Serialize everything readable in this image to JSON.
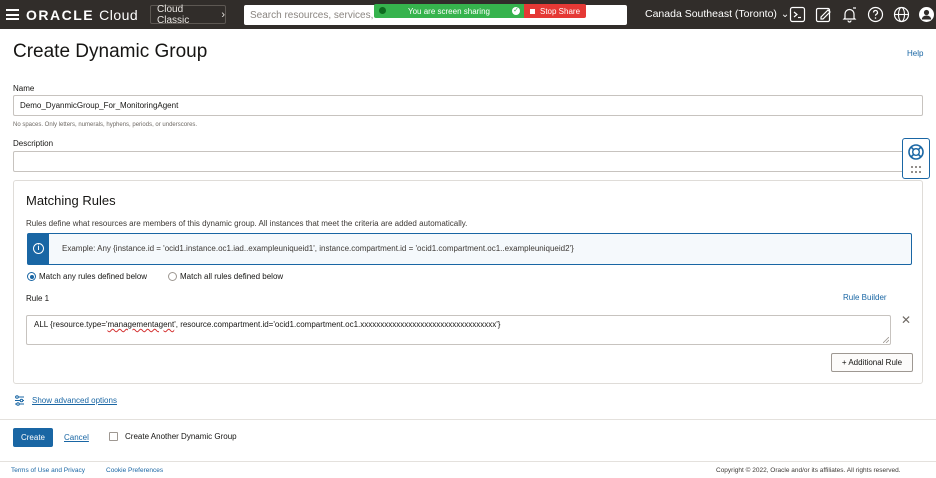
{
  "topbar": {
    "brand": "ORACLE",
    "brand_suffix": "Cloud",
    "classic_label": "Cloud Classic",
    "search_placeholder": "Search resources, services, do",
    "screen_sharing_text": "You are screen sharing",
    "stop_share_label": "Stop Share",
    "region": "Canada Southeast (Toronto)",
    "icons": [
      "terminal-icon",
      "edit-icon",
      "bell-icon",
      "help-icon",
      "globe-icon",
      "user-icon"
    ]
  },
  "page": {
    "title": "Create Dynamic Group",
    "help_link": "Help"
  },
  "form": {
    "name_label": "Name",
    "name_value": "Demo_DyanmicGroup_For_MonitoringAgent",
    "name_hint": "No spaces. Only letters, numerals, hyphens, periods, or underscores.",
    "description_label": "Description",
    "description_value": ""
  },
  "matching_rules": {
    "title": "Matching Rules",
    "description": "Rules define what resources are members of this dynamic group. All instances that meet the criteria are added automatically.",
    "example": "Example: Any {instance.id = 'ocid1.instance.oc1.iad..exampleuniqueid1', instance.compartment.id = 'ocid1.compartment.oc1..exampleuniqueid2'}",
    "options": [
      {
        "label": "Match any rules defined below",
        "selected": true
      },
      {
        "label": "Match all rules defined below",
        "selected": false
      }
    ],
    "rule_label": "Rule 1",
    "rule_builder_link": "Rule Builder",
    "rule_prefix": "ALL {resource.type='",
    "rule_squiggle": "managementagent",
    "rule_suffix": "', resource.compartment.id='ocid1.compartment.oc1.xxxxxxxxxxxxxxxxxxxxxxxxxxxxxxxxxx'}",
    "additional_rule_button": "+ Additional Rule"
  },
  "advanced": {
    "link": "Show advanced options"
  },
  "actions": {
    "create_button": "Create",
    "cancel_link": "Cancel",
    "another_checkbox_label": "Create Another Dynamic Group",
    "another_checked": false
  },
  "footer": {
    "terms": "Terms of Use and Privacy",
    "cookies": "Cookie Preferences",
    "copyright": "Copyright © 2022, Oracle and/or its affiliates. All rights reserved."
  },
  "colors": {
    "topbar_bg": "#312d2a",
    "accent": "#1966a4",
    "share_green": "#36b34d",
    "stop_red": "#e53935"
  }
}
